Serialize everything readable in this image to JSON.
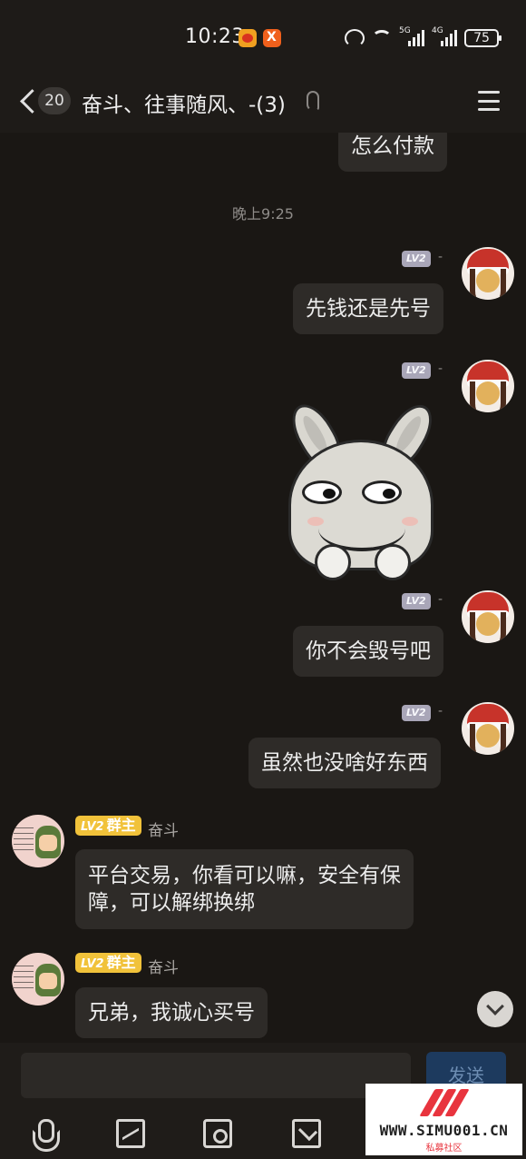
{
  "status_bar": {
    "time": "10:23",
    "signal_tag_1": "5G",
    "signal_tag_2": "4G",
    "battery": "75"
  },
  "header": {
    "unread_count": "20",
    "title": "奋斗、往事随风、-(3)"
  },
  "messages": {
    "top_partial": "怎么付款",
    "timestamp": "晚上9:25",
    "m1": {
      "level": "LV2",
      "name": "-",
      "text": "先钱还是先号"
    },
    "m2": {
      "level": "LV2",
      "name": "-",
      "type": "sticker"
    },
    "m3": {
      "level": "LV2",
      "name": "-",
      "text": "你不会毁号吧"
    },
    "m4": {
      "level": "LV2",
      "name": "-",
      "text": "虽然也没啥好东西"
    },
    "m5": {
      "level": "LV2",
      "role": "群主",
      "name": "奋斗",
      "text_line1": "平台交易，你看可以嘛，安全有保",
      "text_line2": "障，可以解绑换绑"
    },
    "m6": {
      "level": "LV2",
      "role": "群主",
      "name": "奋斗",
      "text": "兄弟，我诚心买号"
    }
  },
  "composer": {
    "input_value": "",
    "send_label": "发送"
  },
  "toolbar_icons": [
    "microphone-icon",
    "image-icon",
    "camera-icon",
    "gift-icon"
  ],
  "watermark": {
    "url": "WWW.SIMU001.CN",
    "sub": "私募社区"
  },
  "colors": {
    "background": "#1a1714",
    "bubble": "#2e2b28",
    "owner_badge": "#f1c23a",
    "send": "#1d3a5e"
  }
}
